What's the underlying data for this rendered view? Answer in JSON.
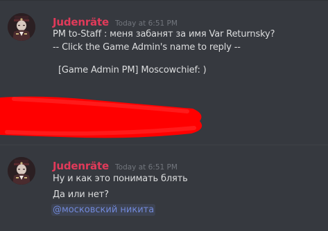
{
  "messages": [
    {
      "username": "Judenräte",
      "timestamp": "Today at 6:51 PM",
      "lines": [
        "PM to-Staff : меня забанят за имя Var Returnsky?",
        "-- Click the Game Admin's name to reply --",
        "[Game Admin PM] Moscowchief: )"
      ]
    },
    {
      "username": "",
      "timestamp": "",
      "lines": [],
      "redacted": true,
      "redaction_color": "#ff0000"
    },
    {
      "username": "Judenräte",
      "timestamp": "Today at 6:51 PM",
      "lines": [
        "Ну и как это понимать блять",
        "Да или нет?"
      ],
      "mention": "@московский никита"
    }
  ],
  "colors": {
    "background": "#36393f",
    "username": "#e23a5a",
    "timestamp": "#72767d",
    "text": "#dcddde",
    "mention": "#7289da"
  }
}
